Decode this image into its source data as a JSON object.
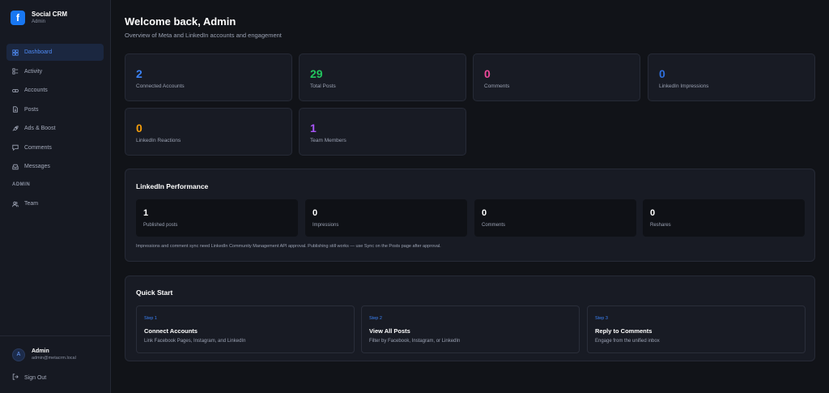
{
  "brand": {
    "title": "Social CRM",
    "subtitle": "Admin",
    "logo_letter": "f",
    "color": "#1877f2"
  },
  "nav": {
    "items": [
      {
        "label": "Dashboard",
        "icon": "dashboard-icon",
        "active": true
      },
      {
        "label": "Activity",
        "icon": "activity-icon"
      },
      {
        "label": "Accounts",
        "icon": "link-icon"
      },
      {
        "label": "Posts",
        "icon": "document-icon"
      },
      {
        "label": "Ads & Boost",
        "icon": "rocket-icon"
      },
      {
        "label": "Comments",
        "icon": "comment-icon"
      },
      {
        "label": "Messages",
        "icon": "inbox-icon"
      }
    ],
    "section_admin": "ADMIN",
    "team": {
      "label": "Team",
      "icon": "users-icon"
    }
  },
  "user": {
    "avatar_letter": "A",
    "name": "Admin",
    "email": "admin@metacrm.local",
    "signout": "Sign Out"
  },
  "header": {
    "title": "Welcome back, Admin",
    "subtitle": "Overview of Meta and LinkedIn accounts and engagement"
  },
  "stats": [
    {
      "value": "2",
      "label": "Connected Accounts",
      "color": "#3b82f6"
    },
    {
      "value": "29",
      "label": "Total Posts",
      "color": "#22c55e"
    },
    {
      "value": "0",
      "label": "Comments",
      "color": "#ec4899"
    },
    {
      "value": "0",
      "label": "LinkedIn Impressions",
      "color": "#2f6fdc"
    },
    {
      "value": "0",
      "label": "LinkedIn Reactions",
      "color": "#f59e0b"
    },
    {
      "value": "1",
      "label": "Team Members",
      "color": "#a855f7"
    }
  ],
  "linkedin": {
    "title": "LinkedIn Performance",
    "metrics": [
      {
        "value": "1",
        "label": "Published posts"
      },
      {
        "value": "0",
        "label": "Impressions"
      },
      {
        "value": "0",
        "label": "Comments"
      },
      {
        "value": "0",
        "label": "Reshares"
      }
    ],
    "note": "Impressions and comment sync need LinkedIn Community Management API approval. Publishing still works — use Sync on the Posts page after approval."
  },
  "quick_start": {
    "title": "Quick Start",
    "steps": [
      {
        "step": "Step 1",
        "title": "Connect Accounts",
        "desc": "Link Facebook Pages, Instagram, and LinkedIn"
      },
      {
        "step": "Step 2",
        "title": "View All Posts",
        "desc": "Filter by Facebook, Instagram, or LinkedIn"
      },
      {
        "step": "Step 3",
        "title": "Reply to Comments",
        "desc": "Engage from the unified inbox"
      }
    ]
  }
}
